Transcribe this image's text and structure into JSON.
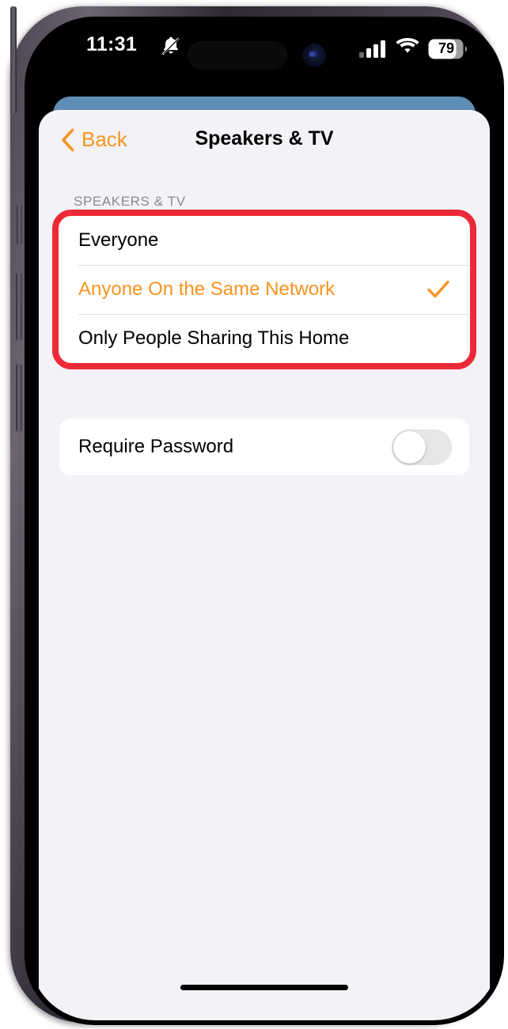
{
  "status_bar": {
    "time": "11:31",
    "silent_icon": "bell-slash-icon",
    "signal_icon": "cellular-signal-icon",
    "wifi_icon": "wifi-icon",
    "battery_level": "79",
    "battery_icon": "battery-icon"
  },
  "nav": {
    "back_label": "Back",
    "back_icon": "chevron-left-icon",
    "title": "Speakers & TV"
  },
  "section": {
    "header": "SPEAKERS & TV"
  },
  "options": [
    {
      "label": "Everyone",
      "selected": false
    },
    {
      "label": "Anyone On the Same Network",
      "selected": true
    },
    {
      "label": "Only People Sharing This Home",
      "selected": false
    }
  ],
  "selected_option": "Anyone On the Same Network",
  "checkmark_icon": "checkmark-icon",
  "toggle_row": {
    "label": "Require Password",
    "state": "off"
  },
  "annotation": {
    "highlight_color": "#ec2a36",
    "highlights": "options-card"
  },
  "colors": {
    "accent_orange": "#f79421",
    "screen_background": "#f2f2f7",
    "card_white": "#ffffff",
    "section_header_gray": "#8a8a8e",
    "toggle_off_track": "#e7e7ea",
    "background_sheet_blue": "#5d8cb4"
  }
}
